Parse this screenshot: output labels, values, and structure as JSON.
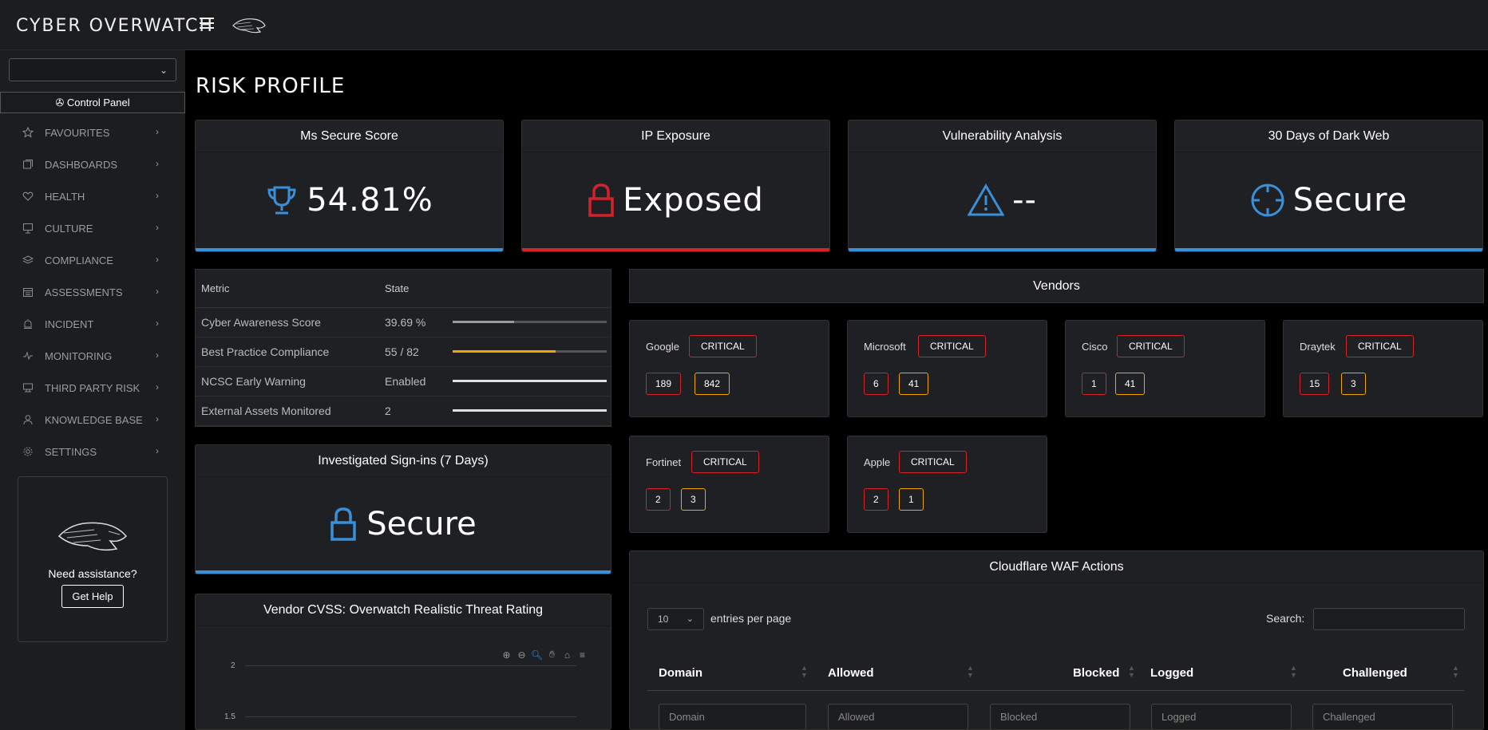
{
  "app": {
    "brand": "CYBER OVERWATCH"
  },
  "sidebar": {
    "control_panel": "Control Panel",
    "items": [
      {
        "label": "FAVOURITES",
        "icon": "star-icon"
      },
      {
        "label": "DASHBOARDS",
        "icon": "dashboard-icon"
      },
      {
        "label": "HEALTH",
        "icon": "heart-icon"
      },
      {
        "label": "CULTURE",
        "icon": "presentation-icon"
      },
      {
        "label": "COMPLIANCE",
        "icon": "layers-icon"
      },
      {
        "label": "ASSESSMENTS",
        "icon": "calendar-icon"
      },
      {
        "label": "INCIDENT",
        "icon": "alarm-icon"
      },
      {
        "label": "MONITORING",
        "icon": "pulse-icon"
      },
      {
        "label": "THIRD PARTY RISK",
        "icon": "link-icon"
      },
      {
        "label": "KNOWLEDGE BASE",
        "icon": "user-icon"
      },
      {
        "label": "SETTINGS",
        "icon": "gear-icon"
      }
    ],
    "help": {
      "title": "Need assistance?",
      "button": "Get Help"
    }
  },
  "page": {
    "title": "RISK PROFILE"
  },
  "stats": [
    {
      "title": "Ms Secure Score",
      "value": "54.81%",
      "icon": "trophy-icon",
      "color": "#3a8fd9"
    },
    {
      "title": "IP Exposure",
      "value": "Exposed",
      "icon": "lock-open-icon",
      "color": "#d2232a"
    },
    {
      "title": "Vulnerability Analysis",
      "value": "--",
      "icon": "warning-icon",
      "color": "#3a8fd9"
    },
    {
      "title": "30 Days of Dark Web",
      "value": "Secure",
      "icon": "crosshair-icon",
      "color": "#3a8fd9"
    }
  ],
  "metrics": {
    "headers": [
      "Metric",
      "State"
    ],
    "rows": [
      {
        "metric": "Cyber Awareness Score",
        "state": "39.69 %",
        "progress": 0.3969,
        "color": "#9a9a9a"
      },
      {
        "metric": "Best Practice Compliance",
        "state": "55 / 82",
        "progress": 0.67,
        "color": "#f0a500"
      },
      {
        "metric": "NCSC Early Warning",
        "state": "Enabled",
        "progress": 1.0,
        "color": "#e0e0e0"
      },
      {
        "metric": "External Assets Monitored",
        "state": "2",
        "progress": 1.0,
        "color": "#e0e0e0"
      }
    ]
  },
  "signins": {
    "title": "Investigated Sign-ins (7 Days)",
    "value": "Secure",
    "icon": "lock-icon"
  },
  "cvss": {
    "title": "Vendor CVSS: Overwatch Realistic Threat Rating",
    "tools": [
      "zoom-in-icon",
      "zoom-out-icon",
      "magnifier-icon",
      "pan-icon",
      "home-icon",
      "menu-icon"
    ],
    "y_ticks": [
      "2",
      "1.5"
    ]
  },
  "vendors": {
    "title": "Vendors",
    "items": [
      {
        "name": "Google",
        "badge": "CRITICAL",
        "red": "189",
        "amber": "842"
      },
      {
        "name": "Microsoft",
        "badge": "CRITICAL",
        "red": "6",
        "amber": "41"
      },
      {
        "name": "Cisco",
        "badge": "CRITICAL",
        "red": "1",
        "amber": "41"
      },
      {
        "name": "Draytek",
        "badge": "CRITICAL",
        "red": "15",
        "amber": "3"
      },
      {
        "name": "Fortinet",
        "badge": "CRITICAL",
        "red": "2",
        "amber": "3"
      },
      {
        "name": "Apple",
        "badge": "CRITICAL",
        "red": "2",
        "amber": "1"
      }
    ]
  },
  "waf": {
    "title": "Cloudflare WAF Actions",
    "per_page_value": "10",
    "per_page_label": "entries per page",
    "search_label": "Search:",
    "columns": [
      "Domain",
      "Allowed",
      "Blocked",
      "Logged",
      "Challenged"
    ],
    "filters": [
      "Domain",
      "Allowed",
      "Blocked",
      "Logged",
      "Challenged"
    ]
  }
}
